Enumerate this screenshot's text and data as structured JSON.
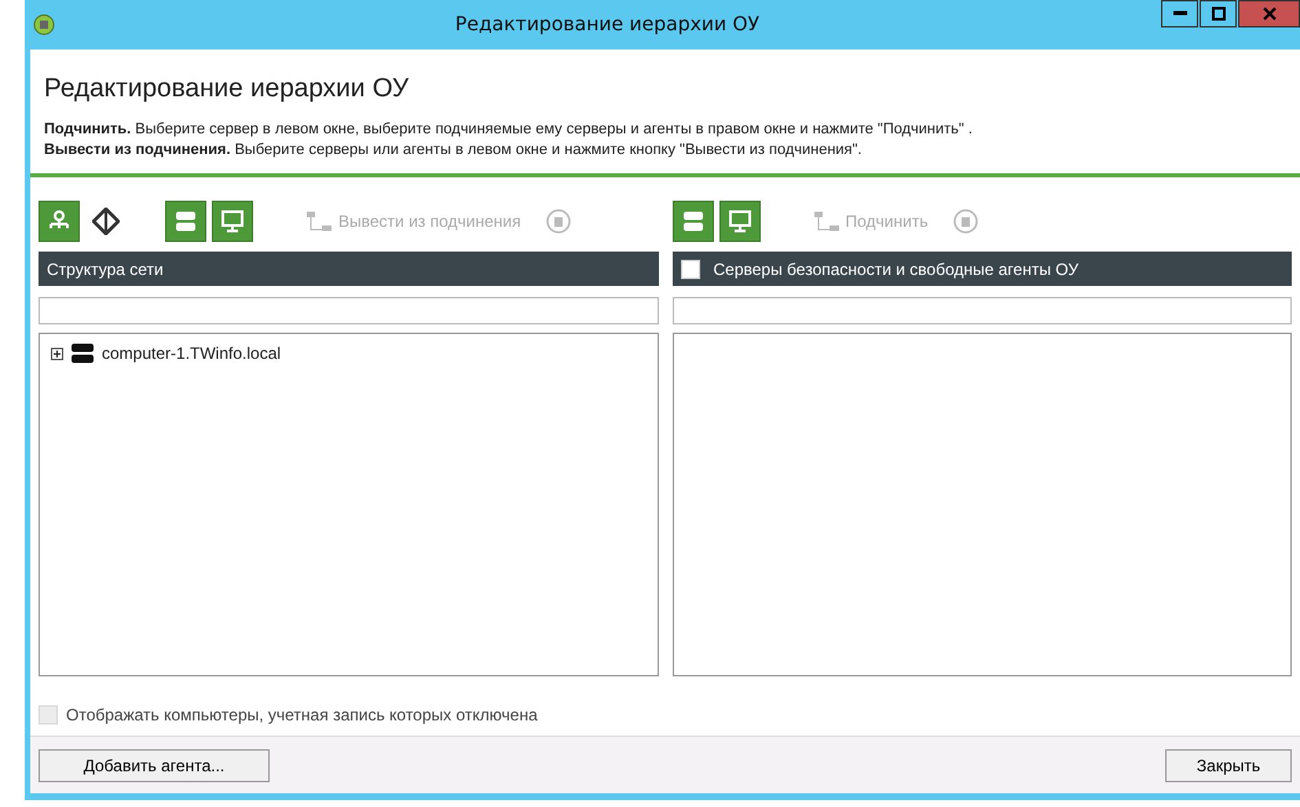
{
  "window": {
    "title": "Редактирование иерархии ОУ"
  },
  "heading": "Редактирование иерархии ОУ",
  "instructions": [
    "**Подчинить.** Выберите сервер в левом окне, выберите подчиняемые ему серверы и агенты в правом окне и нажмите \"Подчинить\" .",
    "**Вывести из подчинения.** Выберите серверы или агенты в левом окне и нажмите кнопку \"Вывести из подчинения\"."
  ],
  "left_panel": {
    "toolbar": [
      {
        "kind": "hierarchy",
        "disabled": false
      },
      {
        "kind": "move",
        "disabled": false
      },
      {
        "kind": "gap"
      },
      {
        "kind": "server",
        "disabled": false
      },
      {
        "kind": "monitor",
        "disabled": false
      },
      {
        "kind": "gap"
      },
      {
        "kind": "action",
        "label": "Вывести из подчинения",
        "disabled": true
      },
      {
        "kind": "delete",
        "disabled": true
      }
    ],
    "header": "Структура сети",
    "tree": [
      {
        "label": "computer-1.TWinfo.local",
        "expanded": false
      }
    ]
  },
  "right_panel": {
    "toolbar": [
      {
        "kind": "server",
        "disabled": false
      },
      {
        "kind": "monitor",
        "disabled": false
      },
      {
        "kind": "gap"
      },
      {
        "kind": "action",
        "label": "Подчинить",
        "disabled": true
      },
      {
        "kind": "delete",
        "disabled": true
      }
    ],
    "header": "Серверы безопасности и свободные агенты ОУ",
    "header_checked": false
  },
  "show_disabled": {
    "label": "Отображать компьютеры, учетная запись которых отключена",
    "checked": false,
    "disabled": true
  },
  "buttons": {
    "left": "Добавить агента...",
    "right": "Закрыть"
  }
}
